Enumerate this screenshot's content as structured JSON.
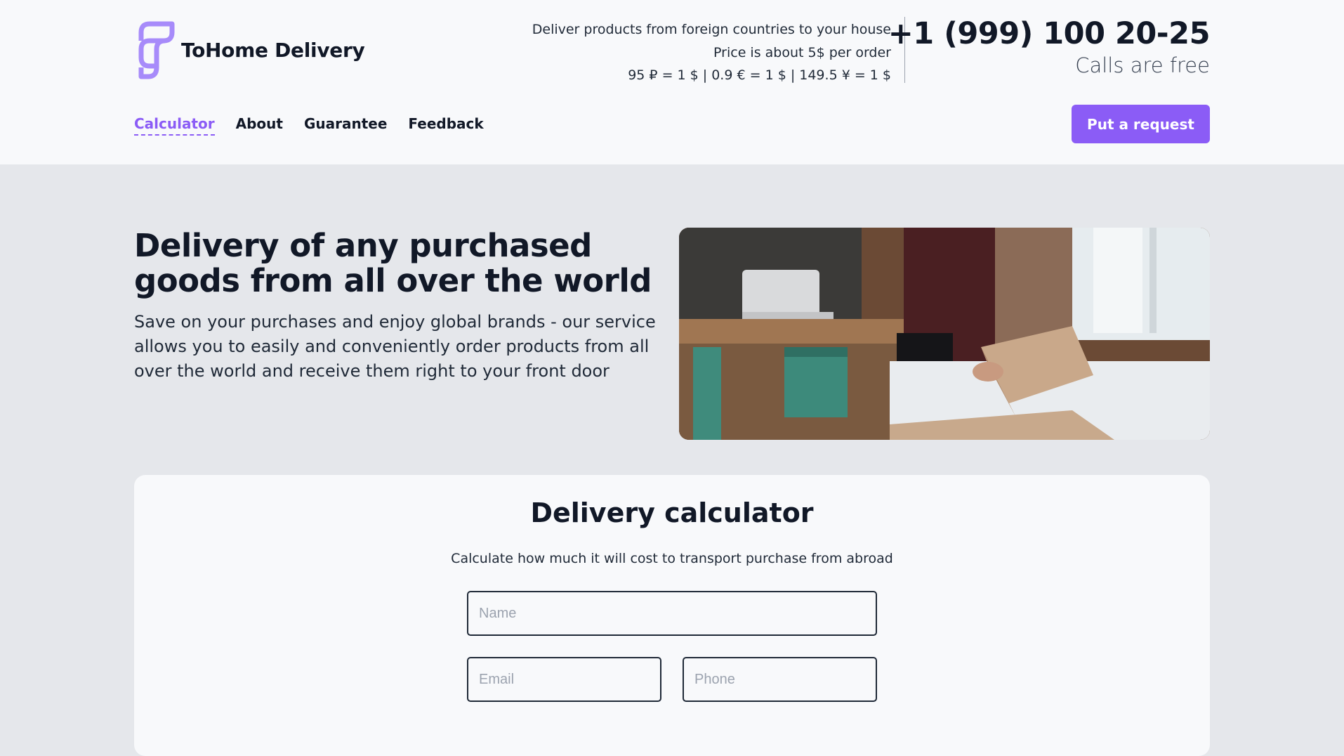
{
  "brand": {
    "name": "ToHome Delivery",
    "accent": "#8b5cf6",
    "logo_icon": "stacked-f-logo-icon"
  },
  "info": {
    "line1": "Deliver products from foreign countries to your house",
    "line2": "Price is about 5$ per order",
    "line3": "95 ₽ = 1 $ | 0.9 € = 1 $ | 149.5 ¥ = 1 $"
  },
  "contact": {
    "phone": "+1 (999) 100 20-25",
    "note": "Calls are free"
  },
  "nav": {
    "items": [
      {
        "label": "Calculator",
        "active": true
      },
      {
        "label": "About",
        "active": false
      },
      {
        "label": "Guarantee",
        "active": false
      },
      {
        "label": "Feedback",
        "active": false
      }
    ]
  },
  "cta": {
    "label": "Put a request"
  },
  "hero": {
    "title": "Delivery of any purchased goods from all over the world",
    "text": "Save on your purchases and enjoy global brands - our service allows you to easily and conveniently order products from all over the world and receive them right to your front door",
    "image": "person-packing-cardboard-box-photo"
  },
  "calculator": {
    "title": "Delivery calculator",
    "subtitle": "Calculate how much it will cost to transport purchase from abroad",
    "fields": {
      "name": {
        "placeholder": "Name",
        "value": ""
      },
      "email": {
        "placeholder": "Email",
        "value": ""
      },
      "phone": {
        "placeholder": "Phone",
        "value": ""
      }
    }
  }
}
